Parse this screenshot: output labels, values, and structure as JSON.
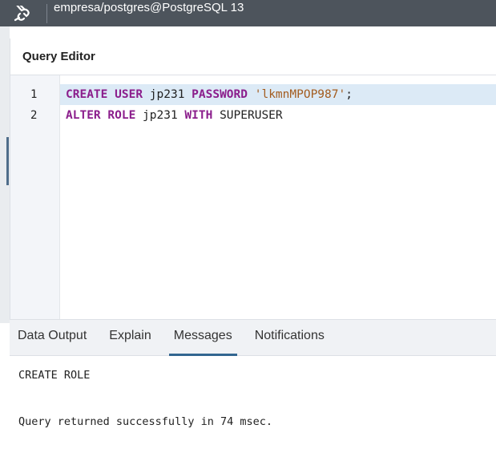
{
  "connection": {
    "icon": "plug-icon",
    "label": "empresa/postgres@PostgreSQL 13"
  },
  "editor": {
    "title": "Query Editor",
    "lines": [
      {
        "number": "1",
        "tokens": [
          {
            "text": "CREATE",
            "type": "kw"
          },
          {
            "text": " ",
            "type": "plain"
          },
          {
            "text": "USER",
            "type": "kw"
          },
          {
            "text": " jp231 ",
            "type": "plain"
          },
          {
            "text": "PASSWORD",
            "type": "kw"
          },
          {
            "text": " ",
            "type": "plain"
          },
          {
            "text": "'lkmnMPOP987'",
            "type": "str"
          },
          {
            "text": ";",
            "type": "plain"
          }
        ]
      },
      {
        "number": "2",
        "tokens": [
          {
            "text": "ALTER",
            "type": "kw"
          },
          {
            "text": " ",
            "type": "plain"
          },
          {
            "text": "ROLE",
            "type": "kw"
          },
          {
            "text": " jp231 ",
            "type": "plain"
          },
          {
            "text": "WITH",
            "type": "kw"
          },
          {
            "text": " SUPERUSER",
            "type": "plain"
          }
        ]
      }
    ],
    "active_line": "1"
  },
  "tabs": [
    {
      "label": "Data Output",
      "name": "tab-data-output",
      "active": false
    },
    {
      "label": "Explain",
      "name": "tab-explain",
      "active": false
    },
    {
      "label": "Messages",
      "name": "tab-messages",
      "active": true
    },
    {
      "label": "Notifications",
      "name": "tab-notifications",
      "active": false
    }
  ],
  "messages": {
    "line1": "CREATE ROLE",
    "line2": "Query returned successfully in 74 msec."
  },
  "colors": {
    "topbar": "#4d545c",
    "keyword": "#8b1e8c",
    "string": "#a35c1f",
    "active_line": "#dceaf6",
    "tab_underline": "#326690"
  }
}
